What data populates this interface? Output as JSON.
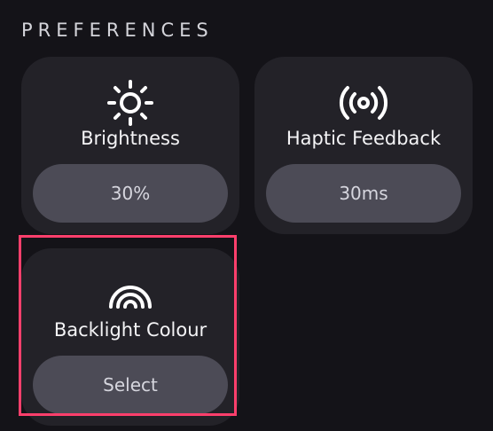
{
  "section": {
    "title": "PREFERENCES"
  },
  "cards": [
    {
      "icon": "sun-icon",
      "label": "Brightness",
      "value": "30%"
    },
    {
      "icon": "haptic-vibration-icon",
      "label": "Haptic Feedback",
      "value": "30ms"
    },
    {
      "icon": "rainbow-arc-icon",
      "label": "Backlight Colour",
      "value": "Select"
    }
  ],
  "colors": {
    "background": "#141318",
    "card": "#232228",
    "button": "#4c4b56",
    "highlight": "#ff3f6c"
  }
}
